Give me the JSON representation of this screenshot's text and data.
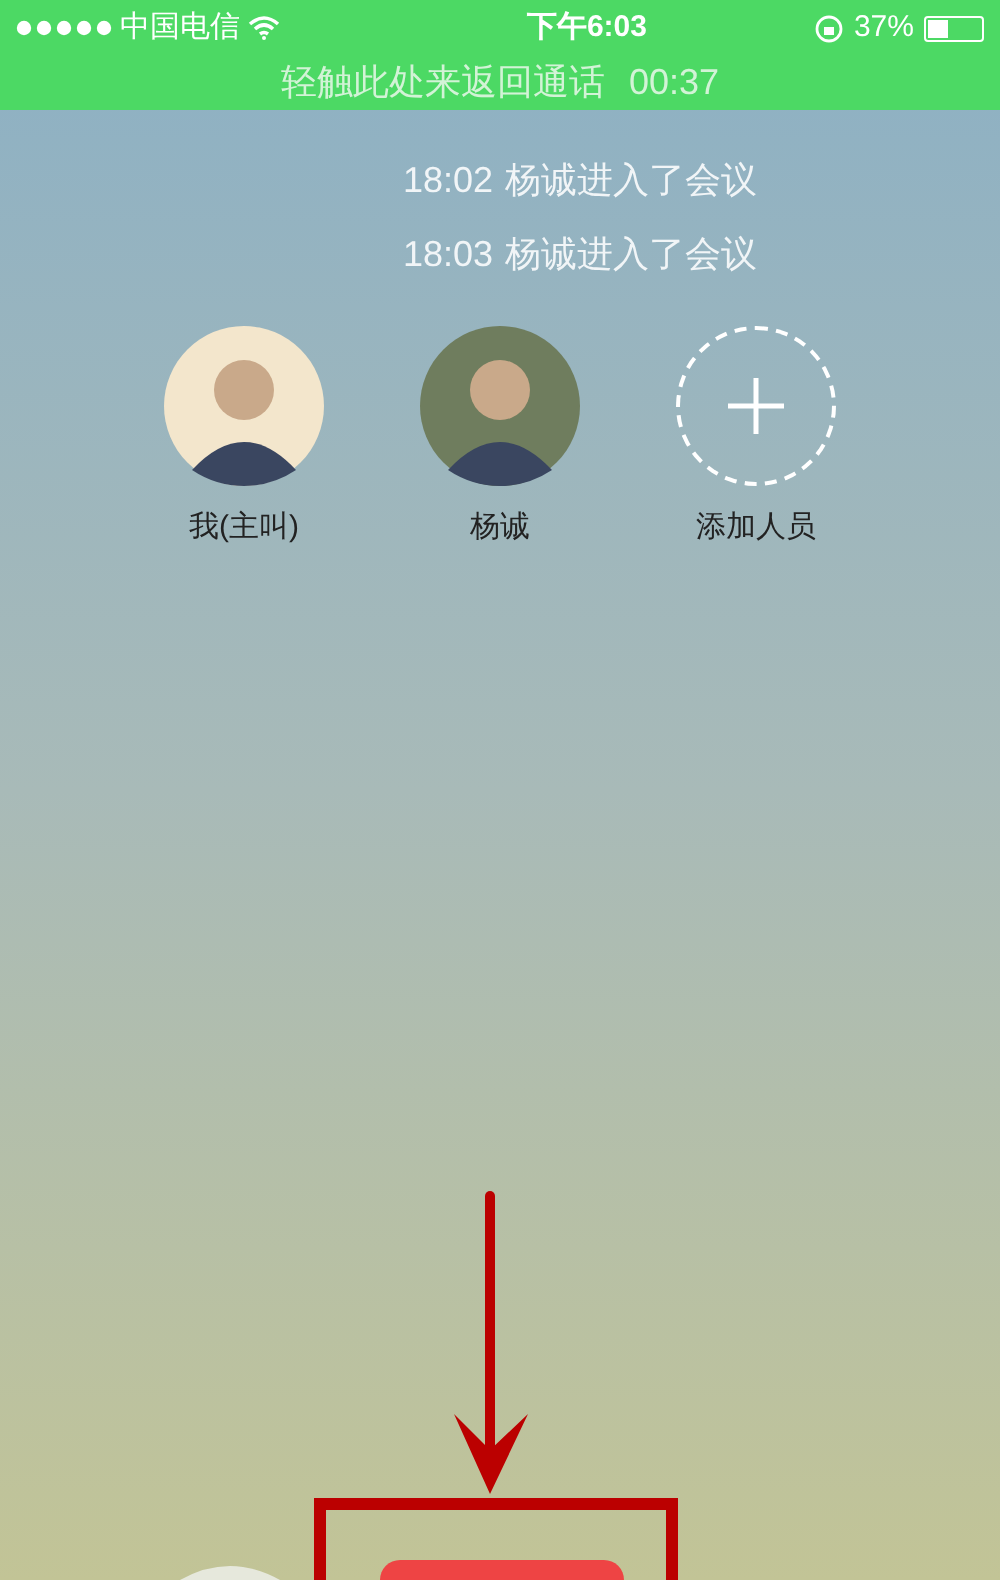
{
  "status_bar": {
    "carrier": "中国电信",
    "time": "下午6:03",
    "battery": {
      "text": "37%",
      "level": 0.37
    }
  },
  "call_banner": {
    "text": "轻触此处来返回通话",
    "timer": "00:37"
  },
  "events": [
    {
      "time": "18:02",
      "text": "杨诚进入了会议"
    },
    {
      "time": "18:03",
      "text": "杨诚进入了会议"
    }
  ],
  "participants": [
    {
      "kind": "avatar",
      "name": "我(主叫)",
      "color": "#f3e6cc"
    },
    {
      "kind": "avatar",
      "name": "杨诚",
      "color": "#6f7d5e"
    },
    {
      "kind": "add",
      "name": "添加人员"
    }
  ]
}
